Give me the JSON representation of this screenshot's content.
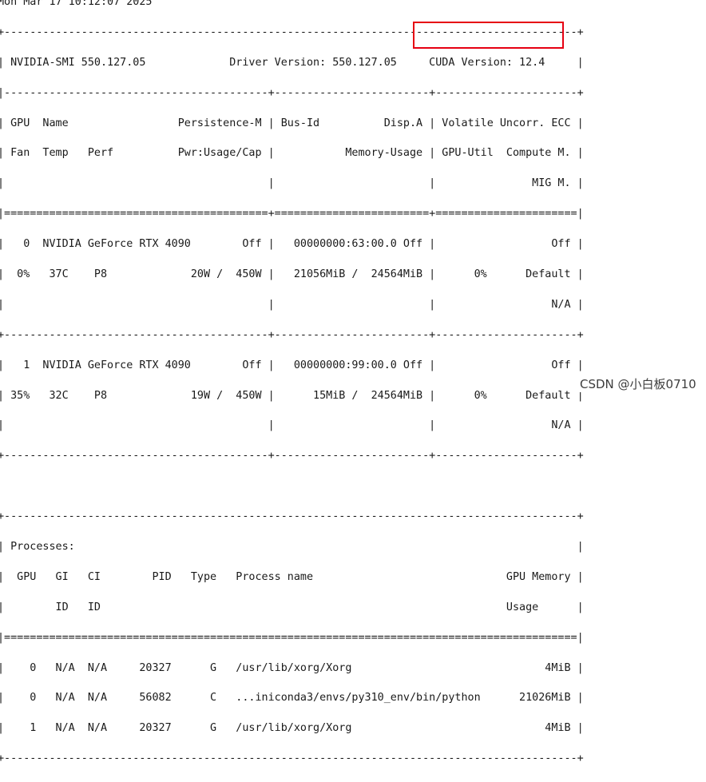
{
  "terminal": {
    "lines": [
      "Mon Mar 17 10:12:07 2025",
      "+-----------------------------------------------------------------------------------------+",
      "| NVIDIA-SMI 550.127.05             Driver Version: 550.127.05     CUDA Version: 12.4     |",
      "|-----------------------------------------+------------------------+----------------------+",
      "| GPU  Name                 Persistence-M | Bus-Id          Disp.A | Volatile Uncorr. ECC |",
      "| Fan  Temp   Perf          Pwr:Usage/Cap |           Memory-Usage | GPU-Util  Compute M. |",
      "|                                         |                        |               MIG M. |",
      "|=========================================+========================+======================|",
      "|   0  NVIDIA GeForce RTX 4090        Off |   00000000:63:00.0 Off |                  Off |",
      "|  0%   37C    P8             20W /  450W |   21056MiB /  24564MiB |      0%      Default |",
      "|                                         |                        |                  N/A |",
      "+-----------------------------------------+------------------------+----------------------+",
      "|   1  NVIDIA GeForce RTX 4090        Off |   00000000:99:00.0 Off |                  Off |",
      "| 35%   32C    P8             19W /  450W |      15MiB /  24564MiB |      0%      Default |",
      "|                                         |                        |                  N/A |",
      "+-----------------------------------------+------------------------+----------------------+",
      "",
      "+-----------------------------------------------------------------------------------------+",
      "| Processes:                                                                              |",
      "|  GPU   GI   CI        PID   Type   Process name                              GPU Memory |",
      "|        ID   ID                                                               Usage      |",
      "|=========================================================================================|",
      "|    0   N/A  N/A     20327      G   /usr/lib/xorg/Xorg                              4MiB |",
      "|    0   N/A  N/A     56082      C   ...iniconda3/envs/py310_env/bin/python      21026MiB |",
      "|    1   N/A  N/A     20327      G   /usr/lib/xorg/Xorg                              4MiB |",
      "+-----------------------------------------------------------------------------------------+"
    ]
  },
  "watermark": {
    "text": "CSDN @小白板0710"
  },
  "colors": {
    "highlight": "#e60012",
    "text": "#1a1a1a",
    "background": "#ffffff"
  }
}
